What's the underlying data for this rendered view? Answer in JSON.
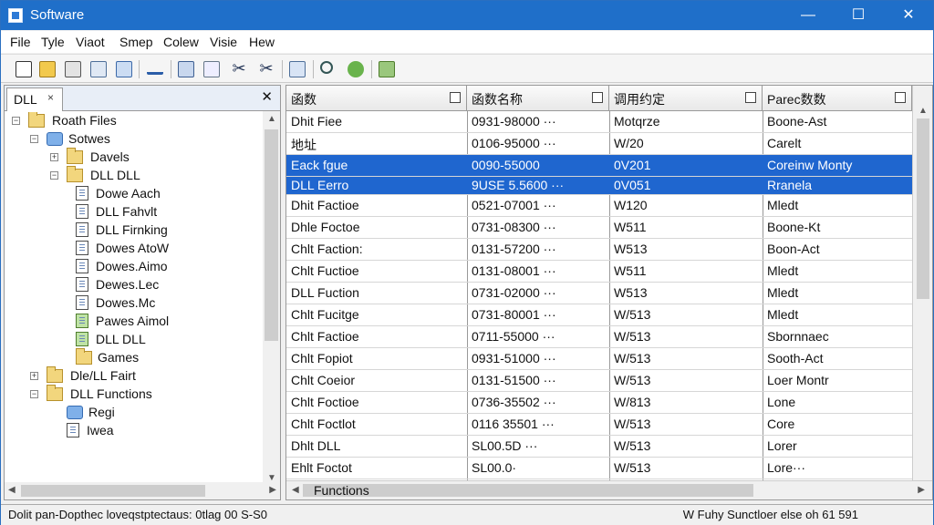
{
  "window": {
    "title": "Software",
    "controls": {
      "minimize": "—",
      "maximize": "☐",
      "close": "✕"
    }
  },
  "menu": {
    "items": [
      "File",
      "Tyle",
      "Viaot",
      "Smep",
      "Colew",
      "Visie",
      "Hew"
    ]
  },
  "toolbar": {
    "icons": [
      "new-document-icon",
      "open-folder-icon",
      "save-icon",
      "properties-icon",
      "document-icon",
      "chart-icon",
      "monitor-icon",
      "graph-icon",
      "cut-icon",
      "scissors-icon",
      "export-icon",
      "search-icon",
      "refresh-icon",
      "filter-icon"
    ]
  },
  "left_pane": {
    "tab_label": "DLL",
    "tab_close": "×",
    "pane_close": "✕",
    "tree": [
      {
        "label": "Roath Files",
        "type": "folder",
        "expander": "−"
      },
      {
        "label": "Sotwes",
        "type": "folder-blue",
        "expander": "−"
      },
      {
        "label": "Davels",
        "type": "folder",
        "expander": "+"
      },
      {
        "label": "DLL DLL",
        "type": "folder",
        "expander": "−"
      },
      {
        "label": "Dowe Aach",
        "type": "doc"
      },
      {
        "label": "DLL Fahvlt",
        "type": "doc"
      },
      {
        "label": "DLL Firnking",
        "type": "doc"
      },
      {
        "label": "Dowes AtoW",
        "type": "doc"
      },
      {
        "label": "Dowes.Aimo",
        "type": "doc"
      },
      {
        "label": "Dewes.Lec",
        "type": "doc"
      },
      {
        "label": "Dowes.Mc",
        "type": "doc"
      },
      {
        "label": "Pawes Aimol",
        "type": "green-doc"
      },
      {
        "label": "DLL DLL",
        "type": "green-doc"
      },
      {
        "label": "Games",
        "type": "folder"
      },
      {
        "label": "Dle/LL Fairt",
        "type": "folder",
        "expander": "+"
      },
      {
        "label": "DLL Functions",
        "type": "folder",
        "expander": "−"
      },
      {
        "label": "Regi",
        "type": "folder-blue"
      },
      {
        "label": "Iwea",
        "type": "doc"
      }
    ]
  },
  "table": {
    "columns": [
      "函数",
      "函数名称",
      "调用约定",
      "Parec数数"
    ],
    "rows": [
      {
        "cells": [
          "Dhit Fiee",
          "0931-98000 ···",
          "Motqrze",
          "Boone-Ast"
        ]
      },
      {
        "cells": [
          "地址",
          "0106-95000 ···",
          "W/20",
          "Carelt"
        ]
      },
      {
        "cells": [
          "Eack fgue",
          "0090-55000",
          "0V201",
          "Coreinw Monty"
        ],
        "selected": true
      },
      {
        "cells": [
          "DLL Eerro",
          "9USE 5.5600 ···",
          "0V051",
          "Rranela"
        ],
        "selected": true,
        "tight": true
      },
      {
        "cells": [
          "Dhit Factioe",
          "0521-07001 ···",
          "W120",
          "Mledt"
        ]
      },
      {
        "cells": [
          "Dhle Foctoe",
          "0731-08300 ···",
          "W511",
          "Boone-Kt"
        ]
      },
      {
        "cells": [
          "Chlt Faction:",
          "0131-57200 ···",
          "W513",
          "Boon-Act"
        ]
      },
      {
        "cells": [
          "Chlt Fuctioe",
          "0131-08001 ···",
          "W511",
          "Mledt"
        ]
      },
      {
        "cells": [
          "DLL Fuction",
          "0731-02000 ···",
          "W513",
          "Mledt"
        ]
      },
      {
        "cells": [
          "Chlt Fucitge",
          "0731-80001 ···",
          "W/513",
          "Mledt"
        ]
      },
      {
        "cells": [
          "Chlt Factioe",
          "0711-55000 ···",
          "W/513",
          "Sbornnaec"
        ]
      },
      {
        "cells": [
          "Chlt Fopiot",
          "0931-51000 ···",
          "W/513",
          "Sooth-Act"
        ]
      },
      {
        "cells": [
          "Chlt Coeior",
          "0131-51500 ···",
          "W/513",
          "Loer Montr"
        ]
      },
      {
        "cells": [
          "Chlt Foctioe",
          "0736-35502 ···",
          "W/813",
          "Lone"
        ]
      },
      {
        "cells": [
          "Chlt Foctlot",
          "0116 35501 ···",
          "W/513",
          "Core"
        ]
      },
      {
        "cells": [
          "Dhlt DLL",
          "SL00.5D ···",
          "W/513",
          "Lorer"
        ]
      },
      {
        "cells": [
          "Ehlt Foctot",
          "SL00.0·",
          "W/513",
          "Lore···"
        ]
      }
    ],
    "bottom_label": "Functions"
  },
  "status": {
    "left": "Dolit pan-Dopthec loveqstptectaus: 0tlag 00 S-S0",
    "right": "W Fuhy Sunctloer else oh 61 591"
  },
  "colors": {
    "titlebar": "#1f6fc9",
    "selection": "#1f66cf"
  }
}
